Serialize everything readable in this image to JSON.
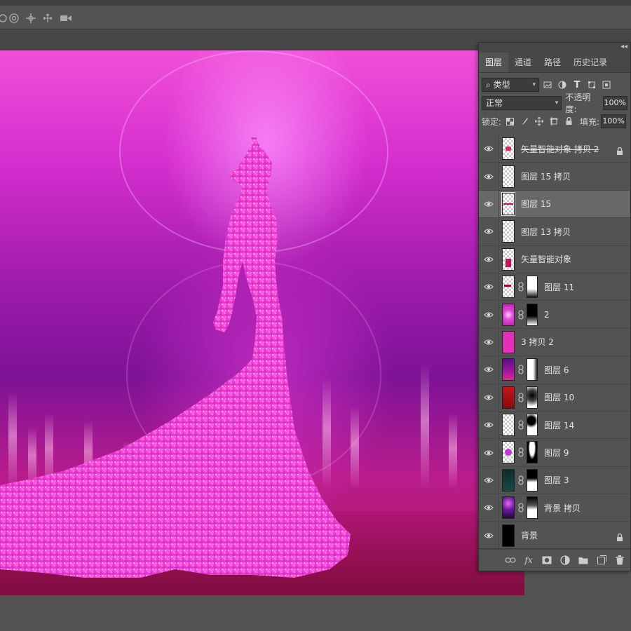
{
  "panel": {
    "tabs": [
      "图层",
      "通道",
      "路径",
      "历史记录"
    ],
    "filter": {
      "label": "类型"
    },
    "blend_mode": "正常",
    "opacity": {
      "label": "不透明度:",
      "value": "100%"
    },
    "lock_label": "锁定:",
    "fill": {
      "label": "填充:",
      "value": "100%"
    },
    "layers": [
      {
        "name": "矢量智能对象 拷贝 2",
        "locked": true
      },
      {
        "name": "图层 15 拷贝"
      },
      {
        "name": "图层 15",
        "selected": true
      },
      {
        "name": "图层 13 拷贝"
      },
      {
        "name": "矢量智能对象"
      },
      {
        "name": "图层 11",
        "mask": true
      },
      {
        "name": "2",
        "mask": true
      },
      {
        "name": "3 拷贝 2"
      },
      {
        "name": "图层 6",
        "mask": true
      },
      {
        "name": "图层 10",
        "mask": true
      },
      {
        "name": "图层 14",
        "mask": true
      },
      {
        "name": "图层 9",
        "mask": true
      },
      {
        "name": "图层 3",
        "mask": true
      },
      {
        "name": "背景 拷贝",
        "mask": true
      },
      {
        "name": "背景",
        "locked": true
      }
    ],
    "bottom_tools": [
      "link-layers-icon",
      "fx",
      "add-mask-icon",
      "adjustment-icon",
      "new-group-icon",
      "new-layer-icon",
      "trash-icon"
    ]
  },
  "colors": {
    "accent_magenta": "#e23cd4",
    "panel_bg": "#535353"
  }
}
